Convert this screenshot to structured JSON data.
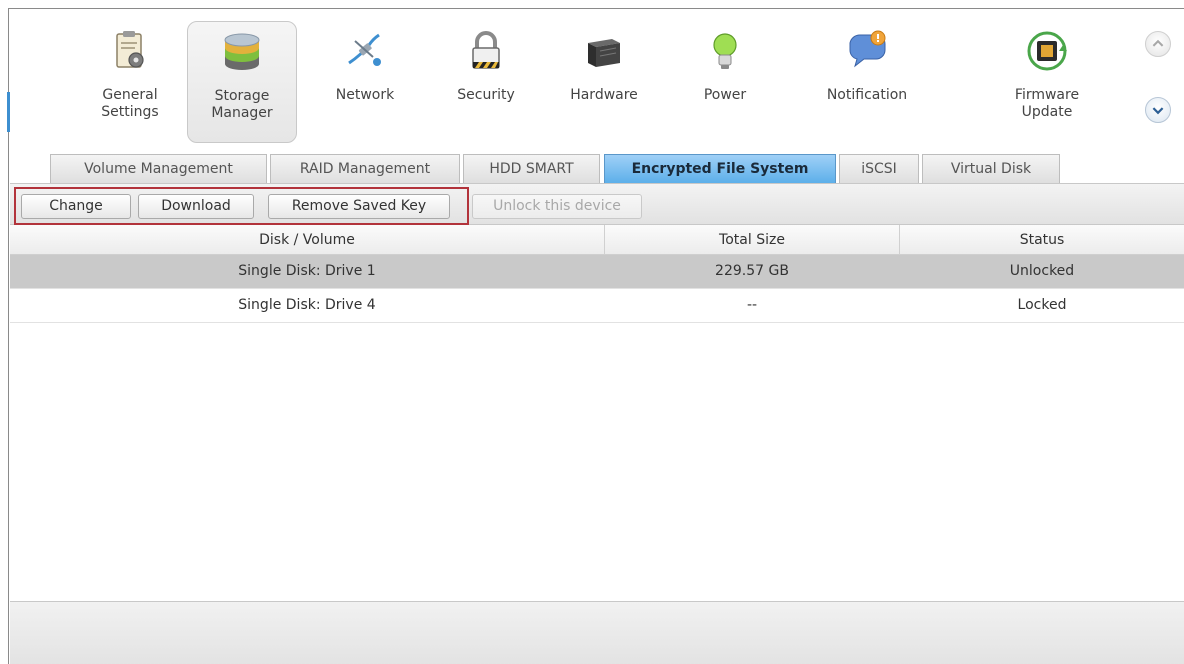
{
  "iconbar": {
    "items": [
      {
        "label": "General\nSettings",
        "icon": "settings-clipboard-icon",
        "active": false
      },
      {
        "label": "Storage\nManager",
        "icon": "disk-stack-icon",
        "active": true
      },
      {
        "label": "Network",
        "icon": "network-satellite-icon",
        "active": false
      },
      {
        "label": "Security",
        "icon": "padlock-icon",
        "active": false
      },
      {
        "label": "Hardware",
        "icon": "hardware-chassis-icon",
        "active": false
      },
      {
        "label": "Power",
        "icon": "light-bulb-icon",
        "active": false
      },
      {
        "label": "Notification",
        "icon": "speech-bubble-alert-icon",
        "active": false
      },
      {
        "label": "Firmware\nUpdate",
        "icon": "chip-refresh-icon",
        "active": false
      }
    ],
    "scroll_up_icon": "chevron-up-icon",
    "scroll_down_icon": "chevron-down-icon"
  },
  "tabs": [
    {
      "label": "Volume Management",
      "active": false
    },
    {
      "label": "RAID Management",
      "active": false
    },
    {
      "label": "HDD SMART",
      "active": false
    },
    {
      "label": "Encrypted File System",
      "active": true
    },
    {
      "label": "iSCSI",
      "active": false
    },
    {
      "label": "Virtual Disk",
      "active": false
    }
  ],
  "toolbar": {
    "change_label": "Change",
    "download_label": "Download",
    "remove_saved_key_label": "Remove Saved Key",
    "unlock_label": "Unlock this device"
  },
  "table": {
    "columns": [
      "Disk / Volume",
      "Total Size",
      "Status"
    ],
    "rows": [
      {
        "volume": "Single Disk: Drive 1",
        "size": "229.57 GB",
        "status": "Unlocked",
        "selected": true
      },
      {
        "volume": "Single Disk: Drive 4",
        "size": "--",
        "status": "Locked",
        "selected": false
      }
    ]
  },
  "colors": {
    "active_tab": "#5aaee9",
    "highlight_box": "#b2333b",
    "selected_row": "#c9c9c9"
  }
}
